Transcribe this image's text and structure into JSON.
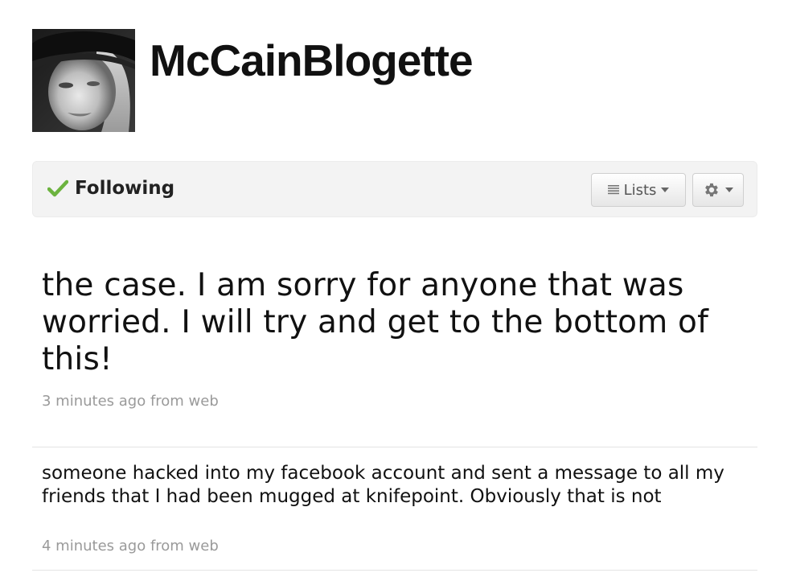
{
  "profile": {
    "username": "McCainBlogette",
    "avatar_icon": "profile-photo"
  },
  "follow_bar": {
    "status_label": "Following",
    "status_icon": "check-icon",
    "status_color": "#6cb33f",
    "lists_label": "Lists",
    "lists_icon": "list-icon",
    "settings_icon": "gear-icon"
  },
  "tweets": [
    {
      "text": "the case. I am sorry for anyone that was worried. I will try and get to the bottom of this!",
      "meta": "3 minutes ago from web"
    },
    {
      "text": "someone hacked into my facebook account and sent a message to all my friends that I had been mugged at knifepoint. Obviously that is not",
      "meta": "4 minutes ago from web"
    }
  ]
}
